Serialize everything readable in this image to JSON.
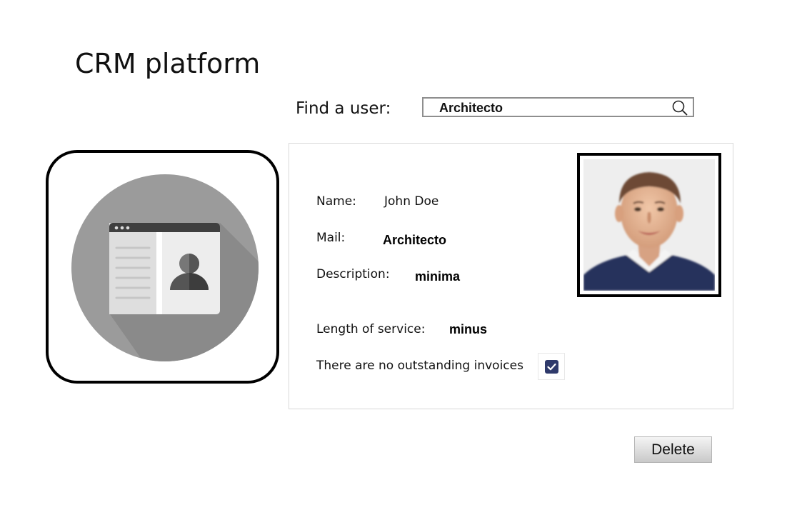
{
  "app": {
    "title": "CRM platform"
  },
  "search": {
    "label": "Find a user:",
    "value": "Architecto"
  },
  "user": {
    "name_label": "Name:",
    "name_value": "John Doe",
    "mail_label": "Mail:",
    "mail_value": "Architecto",
    "description_label": "Description:",
    "description_value": "minima",
    "service_label": "Length of service:",
    "service_value": "minus",
    "invoices_label": "There are no outstanding invoices",
    "invoices_checked": true
  },
  "actions": {
    "delete_label": "Delete"
  },
  "colors": {
    "checkbox_accent": "#2f3a6b",
    "icon_circle": "#9b9b9b"
  },
  "icons": {
    "search": "search-icon",
    "contact": "contact-card-icon",
    "check": "check-icon"
  }
}
